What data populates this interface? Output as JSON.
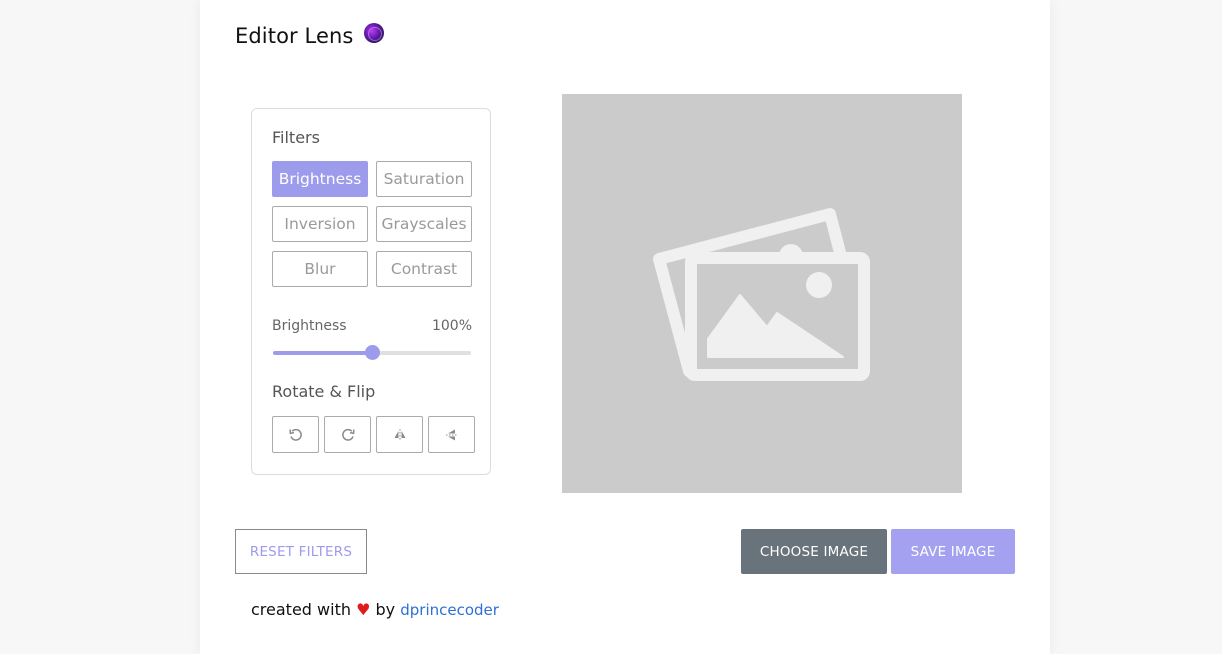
{
  "app": {
    "title": "Editor Lens",
    "logo_icon": "globe-logo-icon"
  },
  "filters": {
    "section_label": "Filters",
    "buttons": [
      {
        "label": "Brightness",
        "active": true
      },
      {
        "label": "Saturation",
        "active": false
      },
      {
        "label": "Inversion",
        "active": false
      },
      {
        "label": "Grayscales",
        "active": false
      },
      {
        "label": "Blur",
        "active": false
      },
      {
        "label": "Contrast",
        "active": false
      }
    ],
    "slider": {
      "name": "Brightness",
      "value_text": "100%",
      "level": 0.5
    }
  },
  "rotate": {
    "section_label": "Rotate & Flip",
    "buttons": [
      {
        "icon": "rotate-left-icon"
      },
      {
        "icon": "rotate-right-icon"
      },
      {
        "icon": "flip-horizontal-icon"
      },
      {
        "icon": "flip-vertical-icon"
      }
    ]
  },
  "preview": {
    "placeholder_icon": "image-placeholder-icon"
  },
  "actions": {
    "reset_label": "RESET FILTERS",
    "choose_label": "CHOOSE IMAGE",
    "save_label": "SAVE IMAGE"
  },
  "footer": {
    "prefix": "created with",
    "heart": "♥",
    "by": "by",
    "author": "dprincecoder"
  },
  "colors": {
    "accent": "#9d9bec",
    "choose_bg": "#69737b",
    "heart": "#e01b1b",
    "link": "#2f6fd6",
    "preview_bg": "#cbcbcb"
  }
}
